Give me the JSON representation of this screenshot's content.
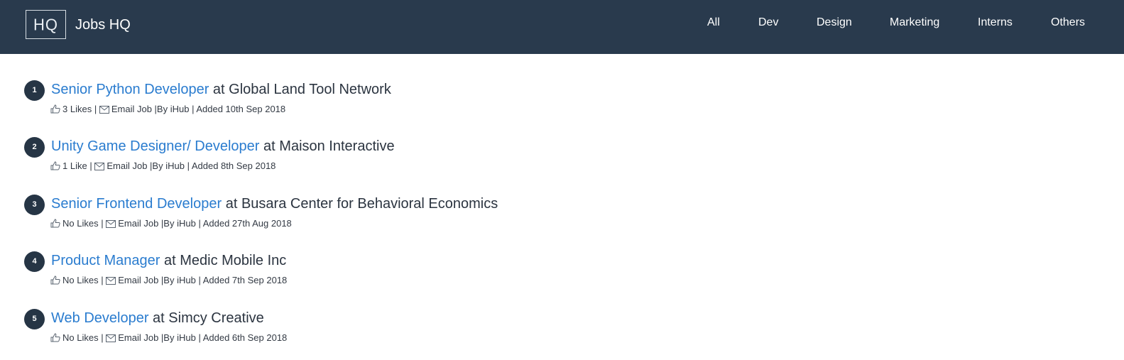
{
  "header": {
    "logo_text": "HQ",
    "brand": "Jobs HQ",
    "nav": [
      {
        "label": "All"
      },
      {
        "label": "Dev"
      },
      {
        "label": "Design"
      },
      {
        "label": "Marketing"
      },
      {
        "label": "Interns"
      },
      {
        "label": "Others"
      }
    ]
  },
  "jobs": [
    {
      "number": "1",
      "title": "Senior Python Developer",
      "at": "at",
      "company": "Global Land Tool Network",
      "likes": "3 Likes",
      "email_label": "Email Job",
      "by": "|By iHub",
      "added": "| Added 10th Sep 2018"
    },
    {
      "number": "2",
      "title": "Unity Game Designer/ Developer",
      "at": "at",
      "company": "Maison Interactive",
      "likes": "1 Like",
      "email_label": "Email Job",
      "by": "|By iHub",
      "added": "| Added 8th Sep 2018"
    },
    {
      "number": "3",
      "title": "Senior Frontend Developer",
      "at": "at",
      "company": "Busara Center for Behavioral Economics",
      "likes": "No Likes",
      "email_label": "Email Job",
      "by": "|By iHub",
      "added": "| Added 27th Aug 2018"
    },
    {
      "number": "4",
      "title": "Product Manager",
      "at": "at",
      "company": "Medic Mobile Inc",
      "likes": "No Likes",
      "email_label": "Email Job",
      "by": "|By iHub",
      "added": "| Added 7th Sep 2018"
    },
    {
      "number": "5",
      "title": "Web Developer",
      "at": "at",
      "company": "Simcy Creative",
      "likes": "No Likes",
      "email_label": "Email Job",
      "by": "|By iHub",
      "added": "| Added 6th Sep 2018"
    }
  ],
  "icons": {
    "like": "thumbs-up-icon",
    "email": "envelope-icon"
  },
  "colors": {
    "header_bg": "#293a4d",
    "link": "#2a7ccf",
    "badge_bg": "#263545"
  }
}
